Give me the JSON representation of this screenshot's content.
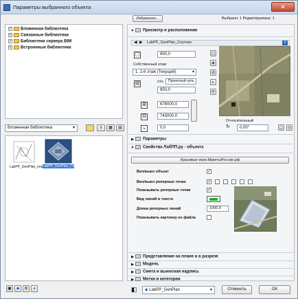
{
  "window": {
    "title": "Параметры выбранного объекта",
    "close": "×"
  },
  "tree": {
    "items": [
      {
        "label": "Вложенная библиотека"
      },
      {
        "label": "Связанные библиотеки"
      },
      {
        "label": "Библиотеки сервера BIM"
      },
      {
        "label": "Встроенные библиотеки"
      }
    ]
  },
  "library": {
    "selected": "Вложенная библиотека",
    "items": [
      {
        "label": "LabPP_GenPlan_план"
      },
      {
        "label": "LabPP_GenPlan_Спутник"
      }
    ]
  },
  "top": {
    "favorites": "Избранное...",
    "selection_info": "Выбрано: 1 Редактируемых: 1"
  },
  "view": {
    "header": "Просмотр и расположение",
    "object_name": "LabPP_GenPlan_Спутник",
    "info_glyph": "i",
    "size": "850,0",
    "own_floor_label": "Собственный этаж:",
    "floor": "1. 1-й этаж (Текущий)",
    "rel_label": "отн.",
    "rel_value": "Проектный нуль",
    "z": "850,0",
    "x": "678000,0",
    "y": "743000,0",
    "angle": "0,0",
    "relative_label": "Относительный",
    "relative_angle": "0,00°"
  },
  "sections": {
    "params": "Параметры",
    "props": "Свойства ЛабПП.ру - объекта",
    "plan": "Представление на плане и в разрезе",
    "model": "Модель",
    "callout": "Смета и выносная надпись",
    "tags": "Метки и категории"
  },
  "props": {
    "link": "Красивые www.МакетыРоссии.рф",
    "rows": [
      {
        "label": "Вкл/выкл объект"
      },
      {
        "label": "Вкл/выкл реперные точки"
      },
      {
        "label": "Показывать реперные точки"
      },
      {
        "label": "Вид линий и текста"
      },
      {
        "label": "Длина реперных линий",
        "value": "1000,0"
      },
      {
        "label": "Показывать картинку из файла"
      }
    ]
  },
  "bottom": {
    "layer": "LabPP_GenPlan",
    "cancel": "Отменить",
    "ok": "OK"
  },
  "colors": {
    "accent": "#2f6fb5",
    "titlebar": "#c5d6ec",
    "close": "#c24b33",
    "header_blue": "#6d95c8"
  }
}
